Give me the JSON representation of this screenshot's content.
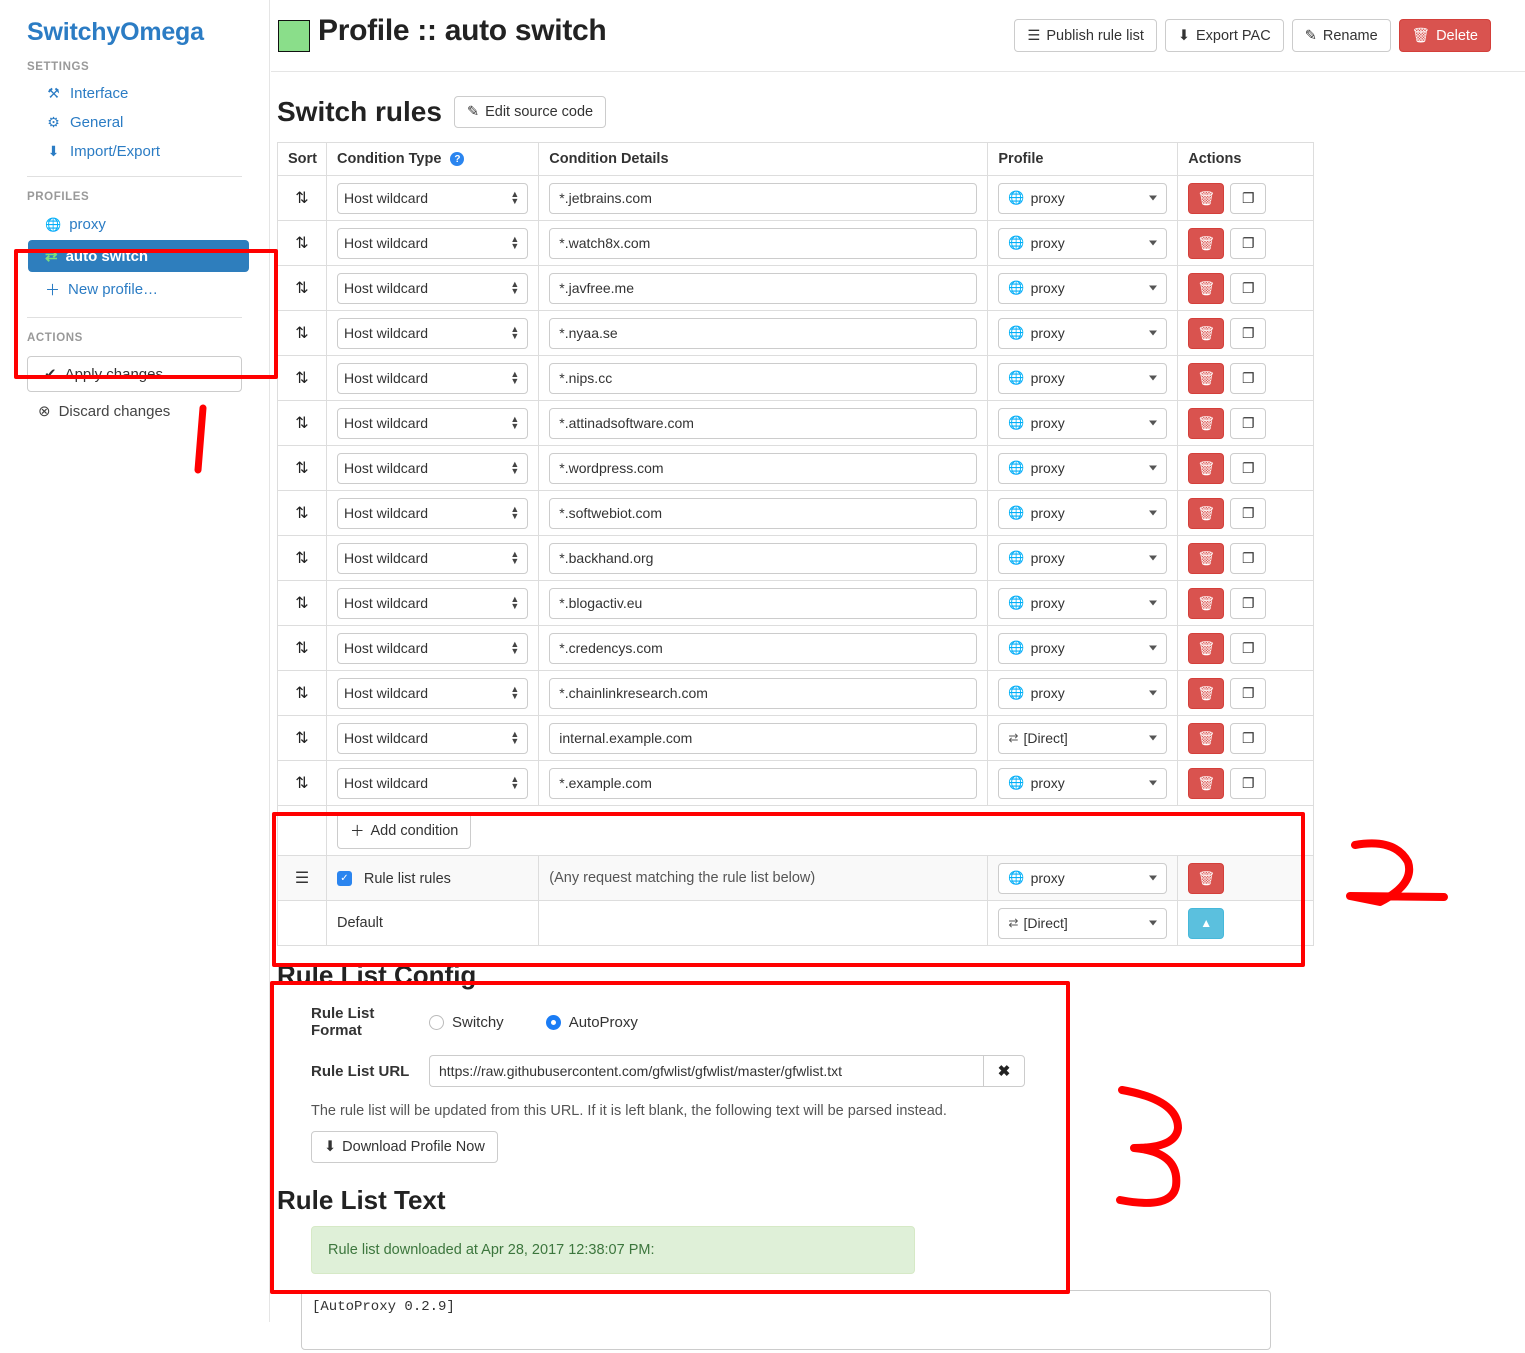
{
  "brand": "SwitchyOmega",
  "sidebar": {
    "settings_header": "SETTINGS",
    "settings_items": [
      {
        "label": "Interface",
        "icon": "wrench-icon",
        "glyph": "⚒"
      },
      {
        "label": "General",
        "icon": "gear-icon",
        "glyph": "⚙"
      },
      {
        "label": "Import/Export",
        "icon": "import-export-icon",
        "glyph": "⬇"
      }
    ],
    "profiles_header": "PROFILES",
    "profiles": [
      {
        "label": "proxy",
        "icon": "globe-icon",
        "glyph": "🌐",
        "active": false
      },
      {
        "label": "auto switch",
        "icon": "auto-switch-icon",
        "glyph": "⇄",
        "active": true
      },
      {
        "label": "New profile…",
        "icon": "plus-icon",
        "glyph": "＋",
        "active": false
      }
    ],
    "actions_header": "ACTIONS",
    "apply_label": "Apply changes",
    "apply_icon_glyph": "✔",
    "discard_label": "Discard changes",
    "discard_icon_glyph": "⊗"
  },
  "header": {
    "title": "Profile :: auto switch",
    "swatch_color": "#8ade8a",
    "buttons": [
      {
        "label": "Publish rule list",
        "icon": "list-icon",
        "glyph": "☰",
        "style": "default"
      },
      {
        "label": "Export PAC",
        "icon": "download-circle-icon",
        "glyph": "⬇",
        "style": "default"
      },
      {
        "label": "Rename",
        "icon": "edit-icon",
        "glyph": "✎",
        "style": "default"
      },
      {
        "label": "Delete",
        "icon": "trash-icon",
        "glyph": "🗑",
        "style": "danger"
      }
    ]
  },
  "switch_rules": {
    "title": "Switch rules",
    "edit_source_label": "Edit source code",
    "edit_source_icon_glyph": "✎",
    "columns": [
      "Sort",
      "Condition Type",
      "Condition Details",
      "Profile",
      "Actions"
    ],
    "condition_type_help_glyph": "?",
    "rows": [
      {
        "type": "Host wildcard",
        "details": "*.jetbrains.com",
        "profile": "proxy",
        "profile_icon": "globe-icon"
      },
      {
        "type": "Host wildcard",
        "details": "*.watch8x.com",
        "profile": "proxy",
        "profile_icon": "globe-icon"
      },
      {
        "type": "Host wildcard",
        "details": "*.javfree.me",
        "profile": "proxy",
        "profile_icon": "globe-icon"
      },
      {
        "type": "Host wildcard",
        "details": "*.nyaa.se",
        "profile": "proxy",
        "profile_icon": "globe-icon"
      },
      {
        "type": "Host wildcard",
        "details": "*.nips.cc",
        "profile": "proxy",
        "profile_icon": "globe-icon"
      },
      {
        "type": "Host wildcard",
        "details": "*.attinadsoftware.com",
        "profile": "proxy",
        "profile_icon": "globe-icon"
      },
      {
        "type": "Host wildcard",
        "details": "*.wordpress.com",
        "profile": "proxy",
        "profile_icon": "globe-icon"
      },
      {
        "type": "Host wildcard",
        "details": "*.softwebiot.com",
        "profile": "proxy",
        "profile_icon": "globe-icon"
      },
      {
        "type": "Host wildcard",
        "details": "*.backhand.org",
        "profile": "proxy",
        "profile_icon": "globe-icon"
      },
      {
        "type": "Host wildcard",
        "details": "*.blogactiv.eu",
        "profile": "proxy",
        "profile_icon": "globe-icon"
      },
      {
        "type": "Host wildcard",
        "details": "*.credencys.com",
        "profile": "proxy",
        "profile_icon": "globe-icon"
      },
      {
        "type": "Host wildcard",
        "details": "*.chainlinkresearch.com",
        "profile": "proxy",
        "profile_icon": "globe-icon"
      },
      {
        "type": "Host wildcard",
        "details": "internal.example.com",
        "profile": "[Direct]",
        "profile_icon": "direct-icon"
      },
      {
        "type": "Host wildcard",
        "details": "*.example.com",
        "profile": "proxy",
        "profile_icon": "globe-icon"
      }
    ],
    "add_condition_label": "Add condition",
    "add_condition_glyph": "＋",
    "rule_list_row": {
      "label": "Rule list rules",
      "checked": true,
      "description": "(Any request matching the rule list below)",
      "profile": "proxy",
      "profile_icon": "globe-icon"
    },
    "default_row": {
      "label": "Default",
      "profile": "[Direct]",
      "profile_icon": "direct-icon"
    },
    "sort_handle_glyph": "⇅",
    "delete_glyph": "🗑",
    "copy_glyph": "❐",
    "up_glyph": "▲"
  },
  "rule_list_config": {
    "title": "Rule List Config",
    "format_label": "Rule List Format",
    "format_options": [
      {
        "label": "Switchy",
        "selected": false
      },
      {
        "label": "AutoProxy",
        "selected": true
      }
    ],
    "url_label": "Rule List URL",
    "url_value": "https://raw.githubusercontent.com/gfwlist/gfwlist/master/gfwlist.txt",
    "clear_glyph": "✖",
    "help_text": "The rule list will be updated from this URL. If it is left blank, the following text will be parsed instead.",
    "download_label": "Download Profile Now",
    "download_glyph": "⬇"
  },
  "rule_list_text": {
    "title": "Rule List Text",
    "alert_message": "Rule list downloaded at Apr 28, 2017 12:38:07 PM:",
    "alert_color": "#dff0d8",
    "textarea_value": "[AutoProxy 0.2.9]"
  },
  "annotations": {
    "accent_color": "#ff0000",
    "marks": [
      {
        "name": "annotation-mark-1",
        "label": "1"
      },
      {
        "name": "annotation-mark-2",
        "label": "2"
      },
      {
        "name": "annotation-mark-3",
        "label": "3"
      }
    ]
  }
}
